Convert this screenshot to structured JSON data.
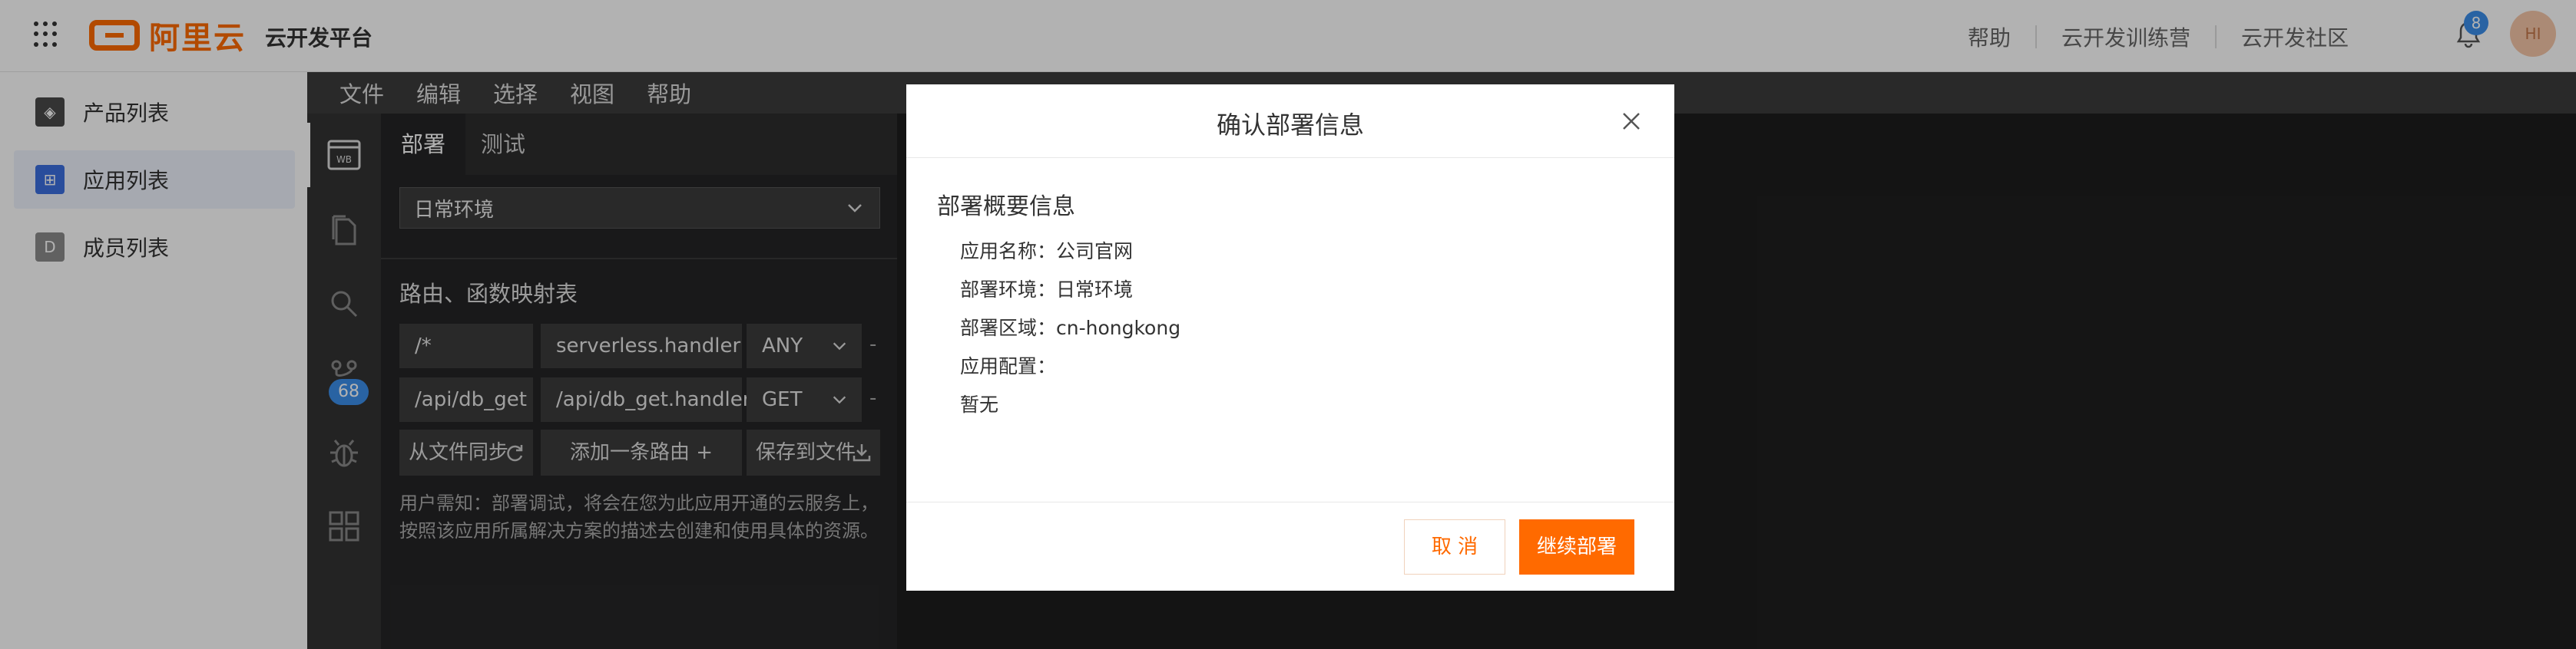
{
  "header": {
    "logo_text": "阿里云",
    "platform_title": "云开发平台",
    "links": [
      "帮助",
      "云开发训练营",
      "云开发社区"
    ],
    "notification_count": "8",
    "avatar_initials": "HI"
  },
  "sidebar": {
    "items": [
      {
        "label": "产品列表",
        "icon": "cube-icon",
        "icon_color": "#4a4a4a"
      },
      {
        "label": "应用列表",
        "icon": "app-grid-icon",
        "icon_color": "#3b6fe0"
      },
      {
        "label": "成员列表",
        "icon": "member-icon",
        "icon_color": "#8c8c8c"
      }
    ],
    "active_index": 1
  },
  "ide": {
    "menu": [
      "文件",
      "编辑",
      "选择",
      "视图",
      "帮助"
    ],
    "activity": {
      "icons": [
        "web-icon",
        "files-icon",
        "search-icon",
        "source-control-icon",
        "debug-icon",
        "extensions-icon"
      ],
      "source_control_count": "68"
    },
    "panel": {
      "tabs": [
        "部署",
        "测试"
      ],
      "active_tab": 0,
      "env_value": "日常环境",
      "section_title": "路由、函数映射表",
      "routes": [
        {
          "path": "/*",
          "handler": "serverless.handler",
          "method": "ANY"
        },
        {
          "path": "/api/db_get",
          "handler": "/api/db_get.handler",
          "method": "GET"
        }
      ],
      "actions": {
        "sync": "从文件同步",
        "add_route": "添加一条路由 +",
        "save": "保存到文件"
      },
      "notice": "用户需知：部署调试，将会在您为此应用开通的云服务上，按照该应用所属解决方案的描述去创建和使用具体的资源。"
    }
  },
  "modal": {
    "title": "确认部署信息",
    "subtitle": "部署概要信息",
    "lines": [
      "应用名称：公司官网",
      "部署环境：日常环境",
      "部署区域：cn-hongkong",
      "应用配置：",
      "暂无"
    ],
    "cancel_label": "取 消",
    "confirm_label": "继续部署"
  },
  "colors": {
    "brand": "#ff6a00",
    "accent_blue": "#3b8eea"
  }
}
